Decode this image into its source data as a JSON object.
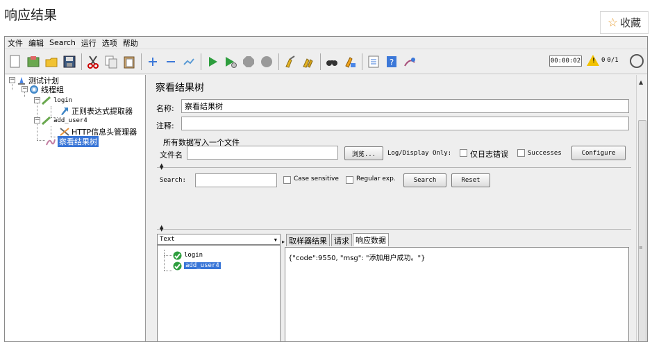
{
  "page": {
    "heading": "响应结果",
    "favorite_label": "收藏",
    "favorite_icon": "star-outline-icon"
  },
  "menu": [
    "文件",
    "编辑",
    "Search",
    "运行",
    "选项",
    "帮助"
  ],
  "toolbar": {
    "icons": [
      "new-icon",
      "templates-icon",
      "open-icon",
      "save-icon",
      "sep",
      "cut-icon",
      "copy-icon",
      "paste-icon",
      "sep",
      "expand-icon",
      "collapse-icon",
      "toggle-icon",
      "sep",
      "start-icon",
      "start-no-pause-icon",
      "stop-icon",
      "shutdown-icon",
      "sep",
      "clear-icon",
      "clear-all-icon",
      "sep",
      "search-binoculars-icon",
      "reset-search-icon",
      "sep",
      "function-helper-icon",
      "help-icon",
      "remote-icon"
    ],
    "timer": "00:00:02",
    "warning_count": "0",
    "threads": "0/1"
  },
  "tree": {
    "test_plan": "测试计划",
    "thread_group": "线程组",
    "sampler_login": "login",
    "regex_extractor": "正则表达式提取器",
    "sampler_add_user": "add_user4",
    "header_manager": "HTTP信息头管理器",
    "result_tree": "察看结果树"
  },
  "panel": {
    "title": "察看结果树",
    "name_label": "名称:",
    "name_value": "察看结果树",
    "comment_label": "注释:",
    "comment_value": "",
    "write_all_label": "所有数据写入一个文件",
    "filename_label": "文件名",
    "filename_value": "",
    "browse_button": "浏览...",
    "log_display_label": "Log/Display Only:",
    "errors_only_label": "仅日志错误",
    "successes_label": "Successes",
    "configure_button": "Configure"
  },
  "search": {
    "label": "Search:",
    "value": "",
    "case_sensitive": "Case sensitive",
    "regular_exp": "Regular exp.",
    "search_button": "Search",
    "reset_button": "Reset"
  },
  "results": {
    "renderer": "Text",
    "items": [
      "login",
      "add_user4"
    ],
    "selected_index": 1,
    "tabs": [
      "取样器结果",
      "请求",
      "响应数据"
    ],
    "active_tab": 2,
    "response_text": "{\"code\":9550, \"msg\": \"添加用户成功。\"}"
  }
}
